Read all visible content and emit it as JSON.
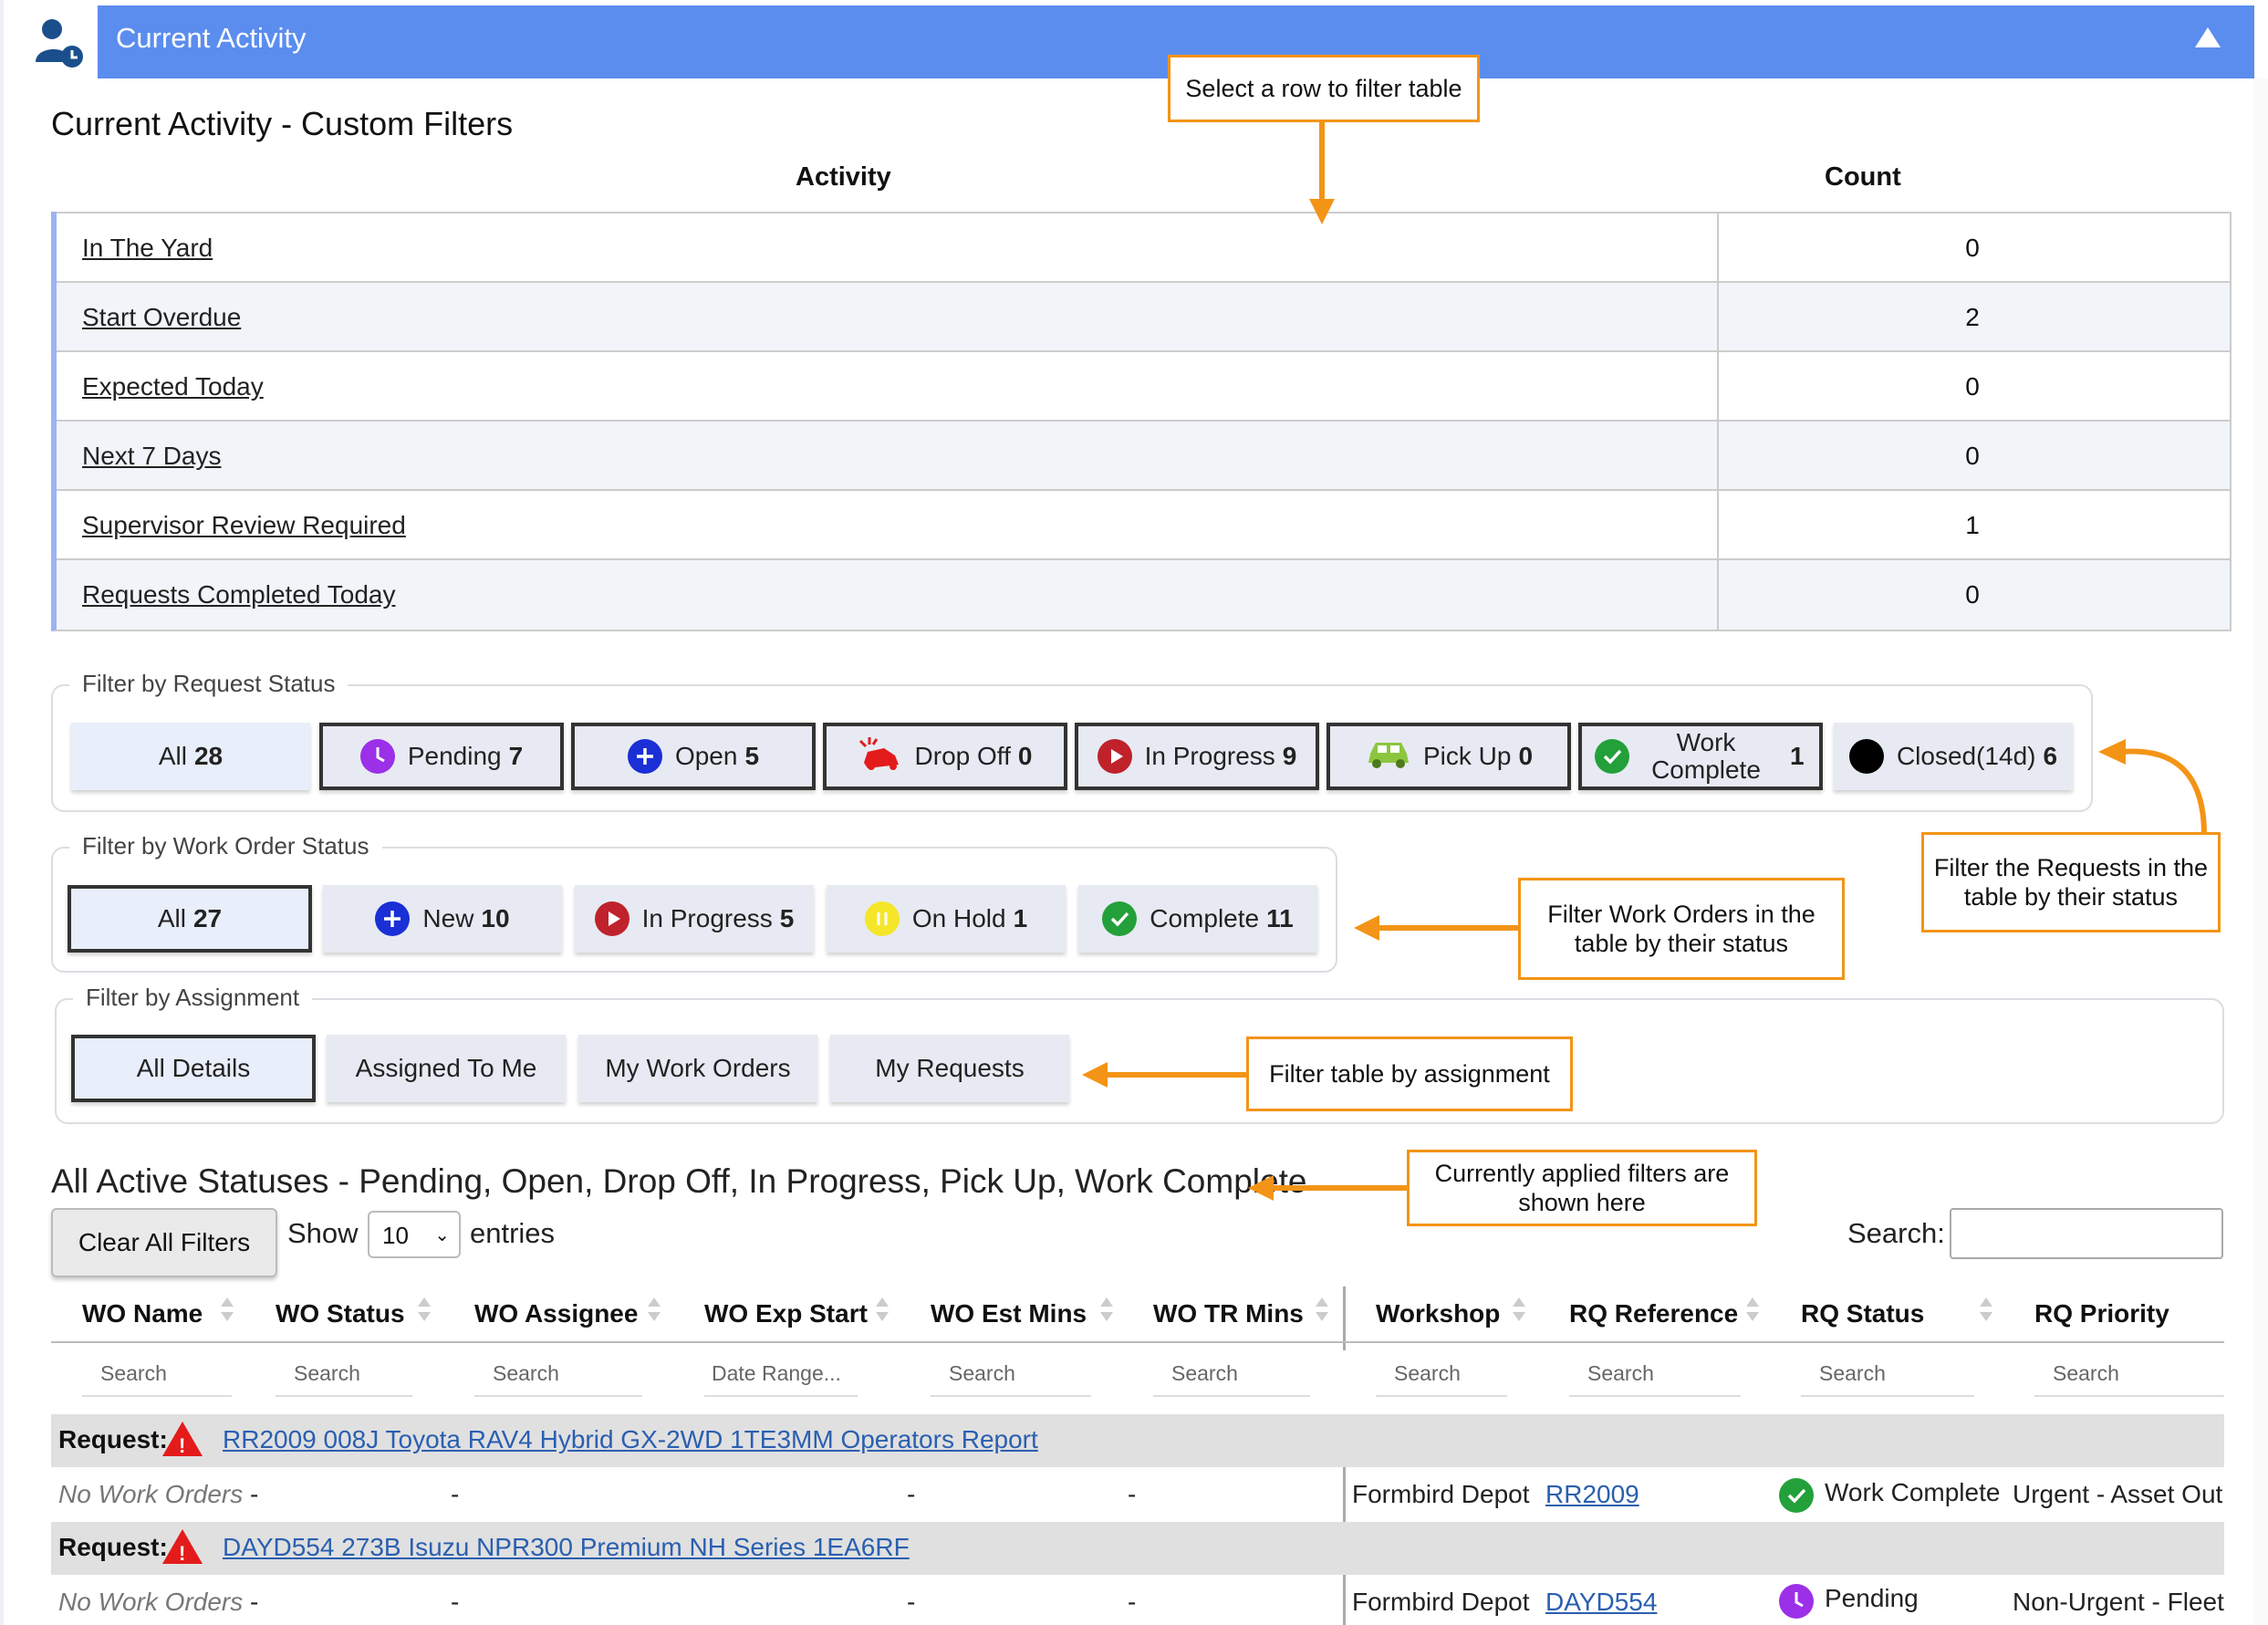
{
  "header": {
    "title": "Current Activity"
  },
  "page_title": "Current Activity - Custom Filters",
  "activity_table": {
    "headers": {
      "activity": "Activity",
      "count": "Count"
    },
    "rows": [
      {
        "label": "In The Yard",
        "count": "0"
      },
      {
        "label": "Start Overdue",
        "count": "2"
      },
      {
        "label": "Expected Today",
        "count": "0"
      },
      {
        "label": "Next 7 Days",
        "count": "0"
      },
      {
        "label": "Supervisor Review Required",
        "count": "1"
      },
      {
        "label": "Requests Completed Today",
        "count": "0"
      }
    ]
  },
  "request_status": {
    "legend": "Filter by Request Status",
    "buttons": [
      {
        "label": "All",
        "count": "28"
      },
      {
        "label": "Pending",
        "count": "7"
      },
      {
        "label": "Open",
        "count": "5"
      },
      {
        "label": "Drop Off",
        "count": "0"
      },
      {
        "label": "In Progress",
        "count": "9"
      },
      {
        "label": "Pick Up",
        "count": "0"
      },
      {
        "label": "Work Complete",
        "count": "1"
      },
      {
        "label": "Closed(14d)",
        "count": "6"
      }
    ]
  },
  "wo_status": {
    "legend": "Filter by Work Order Status",
    "buttons": [
      {
        "label": "All",
        "count": "27"
      },
      {
        "label": "New",
        "count": "10"
      },
      {
        "label": "In Progress",
        "count": "5"
      },
      {
        "label": "On Hold",
        "count": "1"
      },
      {
        "label": "Complete",
        "count": "11"
      }
    ]
  },
  "assignment": {
    "legend": "Filter by Assignment",
    "buttons": [
      "All Details",
      "Assigned To Me",
      "My Work Orders",
      "My Requests"
    ]
  },
  "callouts": {
    "select_row": "Select a row to filter table",
    "filter_requests": "Filter the Requests in the table by their status",
    "filter_wo": "Filter Work Orders in the table by their status",
    "filter_assign": "Filter table by assignment",
    "applied_filters": "Currently applied filters are shown here"
  },
  "active_title": "All Active Statuses - Pending, Open, Drop Off, In Progress, Pick Up, Work Complete",
  "controls": {
    "clear": "Clear All Filters",
    "show": "Show",
    "entries_value": "10",
    "entries": "entries",
    "search": "Search:"
  },
  "columns": [
    {
      "name": "WO Name",
      "search": "Search"
    },
    {
      "name": "WO Status",
      "search": "Search"
    },
    {
      "name": "WO Assignee",
      "search": "Search"
    },
    {
      "name": "WO Exp Start",
      "search": "Date Range..."
    },
    {
      "name": "WO Est Mins",
      "search": "Search"
    },
    {
      "name": "WO TR Mins",
      "search": "Search"
    },
    {
      "name": "Workshop",
      "search": "Search"
    },
    {
      "name": "RQ Reference",
      "search": "Search"
    },
    {
      "name": "RQ Status",
      "search": "Search"
    },
    {
      "name": "RQ Priority",
      "search": "Search"
    }
  ],
  "requests": [
    {
      "label": "Request:",
      "title": "RR2009 008J Toyota RAV4 Hybrid GX-2WD 1TE3MM Operators Report",
      "no_wo": "No Work Orders",
      "dash": "-",
      "workshop": "Formbird Depot",
      "ref": "RR2009",
      "status": "Work Complete",
      "priority": "Urgent - Asset Out"
    },
    {
      "label": "Request:",
      "title": "DAYD554 273B Isuzu NPR300 Premium NH Series 1EA6RF",
      "no_wo": "No Work Orders",
      "dash": "-",
      "workshop": "Formbird Depot",
      "ref": "DAYD554",
      "status": "Pending",
      "priority": "Non-Urgent - Fleet"
    }
  ],
  "colors": {
    "header": "#5b8def",
    "accent_orange": "#f39416",
    "pending": "#9b30e8",
    "open": "#1a2fd6",
    "in_progress": "#c0222b",
    "complete": "#23a03a",
    "on_hold": "#f5e62a"
  }
}
